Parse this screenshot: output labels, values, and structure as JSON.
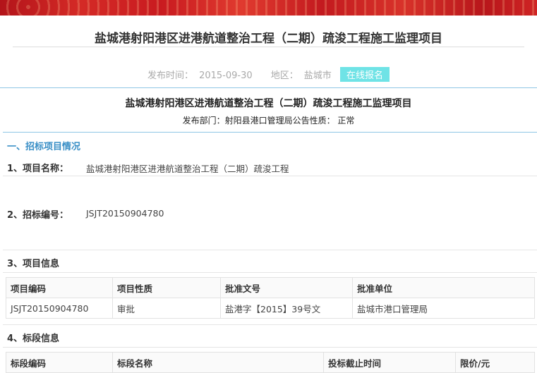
{
  "page": {
    "title": "盐城港射阳港区进港航道整治工程（二期）疏浚工程施工监理项目",
    "publish_label": "发布时间：",
    "publish_date": "2015-09-30",
    "region_label": "地区：",
    "region": "盐城市",
    "apply_button": "在线报名"
  },
  "notice": {
    "title": "盐城港射阳港区进港航道整治工程（二期）疏浚工程施工监理项目",
    "dept_line": "发布部门：射阳县港口管理局公告性质：  正常"
  },
  "section1": {
    "heading": "一、招标项目情况",
    "project_name_label": "1、项目名称：",
    "project_name": "盐城港射阳港区进港航道整治工程（二期）疏浚工程",
    "bid_no_label": "2、招标编号：",
    "bid_no": "JSJT20150904780",
    "project_info_label": "3、项目信息",
    "project_table": {
      "headers": [
        "项目编码",
        "项目性质",
        "批准文号",
        "批准单位"
      ],
      "rows": [
        [
          "JSJT20150904780",
          "审批",
          "盐港字【2015】39号文",
          "盐城市港口管理局"
        ]
      ]
    },
    "lot_info_label": "4、标段信息",
    "lot_table": {
      "headers": [
        "标段编码",
        "标段名称",
        "投标截止时间",
        "限价/元"
      ]
    }
  }
}
